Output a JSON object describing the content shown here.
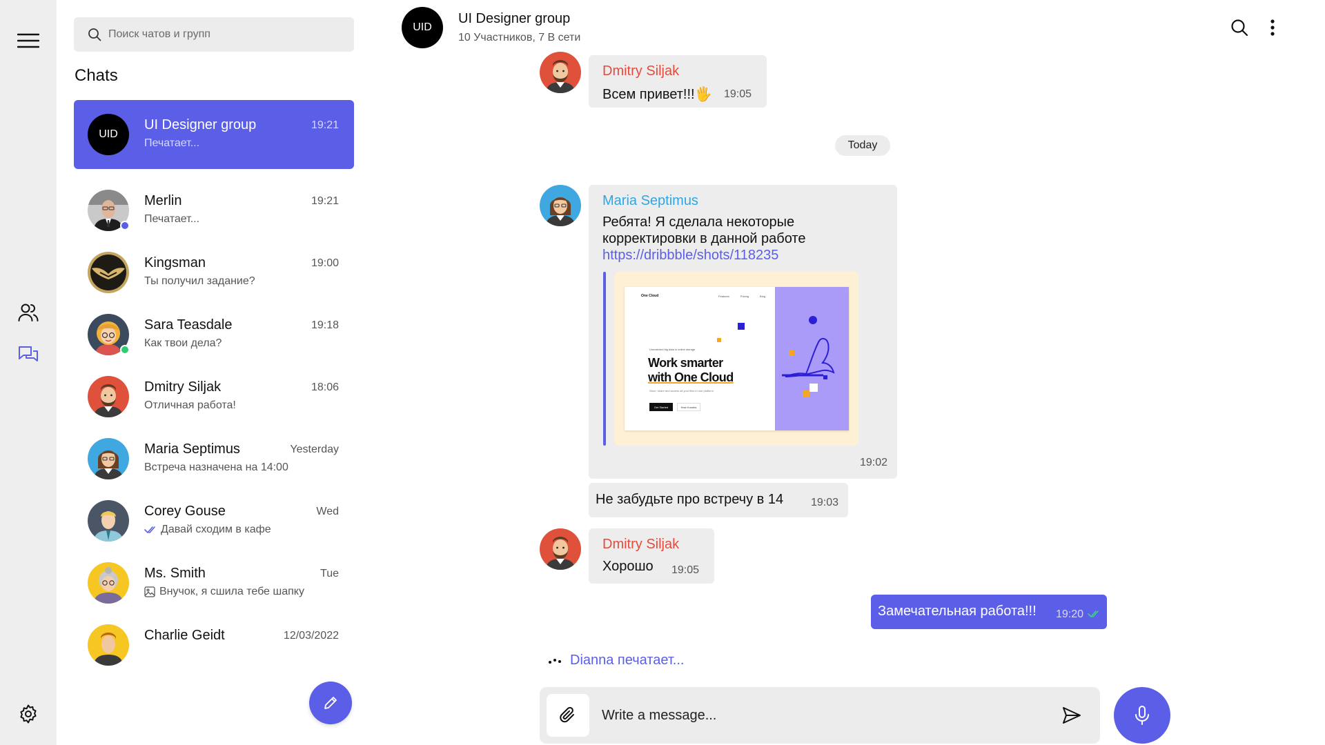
{
  "colors": {
    "accent": "#5b5ee6",
    "rail_bg": "#eeeeee",
    "bubble_bg": "#ededed",
    "sender_red": "#e64a3b",
    "sender_blue": "#2ea6e6",
    "online_green": "#2ecc71",
    "read_check": "#3ecf8e"
  },
  "rail": {
    "icons": [
      "menu-icon",
      "contacts-icon",
      "chats-icon",
      "settings-icon"
    ]
  },
  "search": {
    "placeholder": "Поиск чатов и групп"
  },
  "list": {
    "title": "Chats"
  },
  "chats": [
    {
      "name": "UI Designer group",
      "preview": "Печатает...",
      "time": "19:21",
      "avatar": "UID",
      "active": true
    },
    {
      "name": "Merlin",
      "preview": "Печатает...",
      "time": "19:21",
      "online": "accent"
    },
    {
      "name": "Kingsman",
      "preview": "Ты получил задание?",
      "time": "19:00"
    },
    {
      "name": "Sara Teasdale",
      "preview": "Как твои дела?",
      "time": "19:18",
      "online": "green"
    },
    {
      "name": "Dmitry Siljak",
      "preview": "Отличная работа!",
      "time": "18:06"
    },
    {
      "name": "Maria Septimus",
      "preview": "Встреча назначена на 14:00",
      "time": "Yesterday"
    },
    {
      "name": "Corey Gouse",
      "preview": "Давай сходим в кафе",
      "time": "Wed",
      "icon": "double-check-icon"
    },
    {
      "name": "Ms. Smith",
      "preview": "Внучок, я сшила тебе шапку",
      "time": "Tue",
      "icon": "image-icon"
    },
    {
      "name": "Charlie Geidt",
      "preview": "",
      "time": "12/03/2022"
    }
  ],
  "header": {
    "avatar": "UID",
    "title": "UI Designer group",
    "subtitle": "10 Участников, 7 В сети"
  },
  "messages": {
    "m1": {
      "sender": "Dmitry Siljak",
      "text": "Всем привет!!!🖐",
      "time": "19:05"
    },
    "date_divider": "Today",
    "m2": {
      "sender": "Maria Septimus",
      "line1": "Ребята! Я сделала некоторые",
      "line2": "корректировки в данной работе",
      "link": "https://dribbble/shots/118235",
      "time": "19:02"
    },
    "link_preview": {
      "logo": "One Cloud",
      "nav": [
        "Features",
        "Pricing",
        "Blog"
      ],
      "tag": "Unmatched big data in online storage",
      "headline_1": "Work smarter",
      "headline_2": "with One Cloud",
      "body": "Store, share and access all your files in one platform",
      "cta": "Get Started",
      "cta2": "How it works"
    },
    "m3": {
      "text": "Не забудьте про встречу в 14",
      "time": "19:03"
    },
    "m4": {
      "sender": "Dmitry Siljak",
      "text": "Хорошо",
      "time": "19:05"
    },
    "mine": {
      "text": "Замечательная работа!!!",
      "time": "19:20"
    }
  },
  "typing": {
    "text": "Dianna печатает..."
  },
  "composer": {
    "placeholder": "Write a message..."
  }
}
